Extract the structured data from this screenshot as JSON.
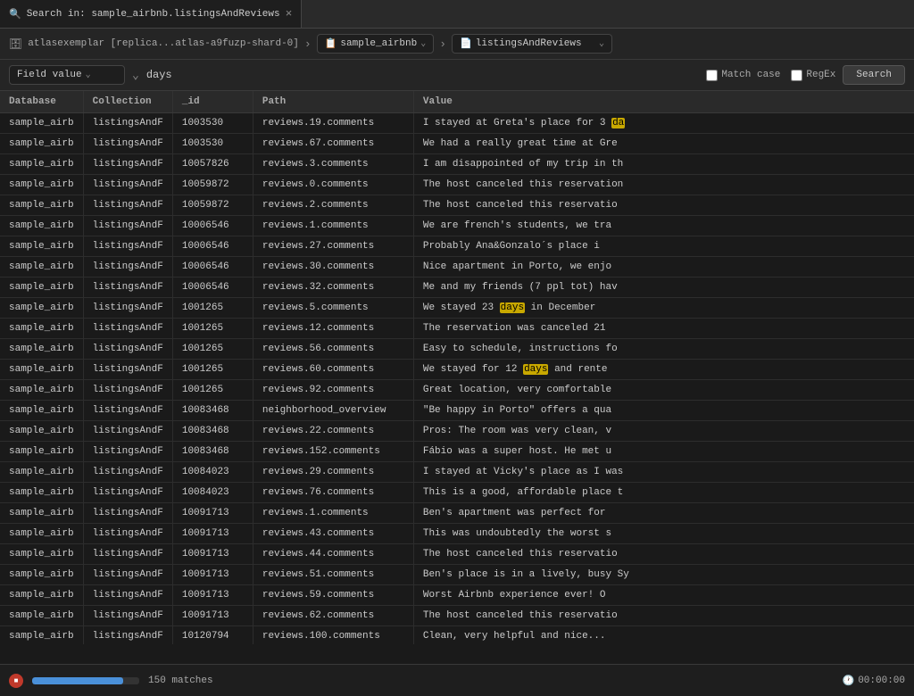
{
  "tab": {
    "label": "Search in: sample_airbnb.listingsAndReviews",
    "close_label": "×"
  },
  "toolbar": {
    "db_icon": "🗄",
    "atlas_label": "atlasexemplar [replica...atlas-a9fuzp-shard-0]",
    "arrow": "›",
    "collection_icon": "📄",
    "db_name": "sample_airbnb",
    "collection_name": "listingsAndReviews",
    "chevron": "⌄"
  },
  "searchbar": {
    "field_label": "Field value",
    "search_value": "days",
    "match_case_label": "Match case",
    "regex_label": "RegEx",
    "search_button": "Search"
  },
  "table": {
    "columns": [
      "Database",
      "Collection",
      "_id",
      "Path",
      "Value"
    ],
    "rows": [
      {
        "database": "sample_airb",
        "collection": "listingsAndF",
        "id": "1003530",
        "path": "reviews.19.comments",
        "value": "I stayed at Greta's place for 3 da",
        "highlight": "da"
      },
      {
        "database": "sample_airb",
        "collection": "listingsAndF",
        "id": "1003530",
        "path": "reviews.67.comments",
        "value": "We had a really great time at Gre",
        "highlight": null
      },
      {
        "database": "sample_airb",
        "collection": "listingsAndF",
        "id": "10057826",
        "path": "reviews.3.comments",
        "value": "I am disappointed of my trip in th",
        "highlight": null
      },
      {
        "database": "sample_airb",
        "collection": "listingsAndF",
        "id": "10059872",
        "path": "reviews.0.comments",
        "value": "The host canceled this reservation",
        "highlight": null
      },
      {
        "database": "sample_airb",
        "collection": "listingsAndF",
        "id": "10059872",
        "path": "reviews.2.comments",
        "value": "The host canceled this reservatio",
        "highlight": null
      },
      {
        "database": "sample_airb",
        "collection": "listingsAndF",
        "id": "10006546",
        "path": "reviews.1.comments",
        "value": "We are french's students, we tra",
        "highlight": null
      },
      {
        "database": "sample_airb",
        "collection": "listingsAndF",
        "id": "10006546",
        "path": "reviews.27.comments",
        "value": "Probably Ana&Gonzalo´s place i",
        "highlight": null
      },
      {
        "database": "sample_airb",
        "collection": "listingsAndF",
        "id": "10006546",
        "path": "reviews.30.comments",
        "value": "Nice apartment in Porto, we enjo",
        "highlight": null
      },
      {
        "database": "sample_airb",
        "collection": "listingsAndF",
        "id": "10006546",
        "path": "reviews.32.comments",
        "value": "Me and my friends (7 ppl tot) hav",
        "highlight": null
      },
      {
        "database": "sample_airb",
        "collection": "listingsAndF",
        "id": "1001265",
        "path": "reviews.5.comments",
        "value_before": "We stayed 23 ",
        "highlight": "days",
        "value_after": " in December"
      },
      {
        "database": "sample_airb",
        "collection": "listingsAndF",
        "id": "1001265",
        "path": "reviews.12.comments",
        "value": "The reservation was canceled 21",
        "highlight": null
      },
      {
        "database": "sample_airb",
        "collection": "listingsAndF",
        "id": "1001265",
        "path": "reviews.56.comments",
        "value": "Easy to schedule, instructions fo",
        "highlight": null
      },
      {
        "database": "sample_airb",
        "collection": "listingsAndF",
        "id": "1001265",
        "path": "reviews.60.comments",
        "value_before": "We stayed for 12 ",
        "highlight": "days",
        "value_after": " and rente"
      },
      {
        "database": "sample_airb",
        "collection": "listingsAndF",
        "id": "1001265",
        "path": "reviews.92.comments",
        "value": "Great location, very comfortable",
        "highlight": null
      },
      {
        "database": "sample_airb",
        "collection": "listingsAndF",
        "id": "10083468",
        "path": "neighborhood_overview",
        "value": "\"Be happy in Porto\"  offers a qua",
        "highlight": null
      },
      {
        "database": "sample_airb",
        "collection": "listingsAndF",
        "id": "10083468",
        "path": "reviews.22.comments",
        "value": "Pros: The room was very clean, v",
        "highlight": null
      },
      {
        "database": "sample_airb",
        "collection": "listingsAndF",
        "id": "10083468",
        "path": "reviews.152.comments",
        "value": "Fábio was a super host. He met u",
        "highlight": null
      },
      {
        "database": "sample_airb",
        "collection": "listingsAndF",
        "id": "10084023",
        "path": "reviews.29.comments",
        "value": "I stayed at Vicky's place as I was",
        "highlight": null
      },
      {
        "database": "sample_airb",
        "collection": "listingsAndF",
        "id": "10084023",
        "path": "reviews.76.comments",
        "value": "This is a good, affordable place t",
        "highlight": null
      },
      {
        "database": "sample_airb",
        "collection": "listingsAndF",
        "id": "10091713",
        "path": "reviews.1.comments",
        "value": "Ben's apartment was perfect for",
        "highlight": null
      },
      {
        "database": "sample_airb",
        "collection": "listingsAndF",
        "id": "10091713",
        "path": "reviews.43.comments",
        "value": "This was undoubtedly the worst s",
        "highlight": null
      },
      {
        "database": "sample_airb",
        "collection": "listingsAndF",
        "id": "10091713",
        "path": "reviews.44.comments",
        "value": "The host canceled this reservatio",
        "highlight": null
      },
      {
        "database": "sample_airb",
        "collection": "listingsAndF",
        "id": "10091713",
        "path": "reviews.51.comments",
        "value": "Ben's place is in a lively, busy Sy",
        "highlight": null
      },
      {
        "database": "sample_airb",
        "collection": "listingsAndF",
        "id": "10091713",
        "path": "reviews.59.comments",
        "value": "Worst Airbnb experience ever! O",
        "highlight": null
      },
      {
        "database": "sample_airb",
        "collection": "listingsAndF",
        "id": "10091713",
        "path": "reviews.62.comments",
        "value": "The host canceled this reservatio",
        "highlight": null
      },
      {
        "database": "sample_airb",
        "collection": "listingsAndF",
        "id": "10120794",
        "path": "reviews.100.comments",
        "value": "Clean, very helpful and nice...",
        "highlight": null
      }
    ]
  },
  "statusbar": {
    "matches": "150 matches",
    "timer": "00:00:00",
    "progress": 85
  },
  "icons": {
    "database": "🗄",
    "collection": "📋",
    "clock": "🕐",
    "stop": "■"
  }
}
